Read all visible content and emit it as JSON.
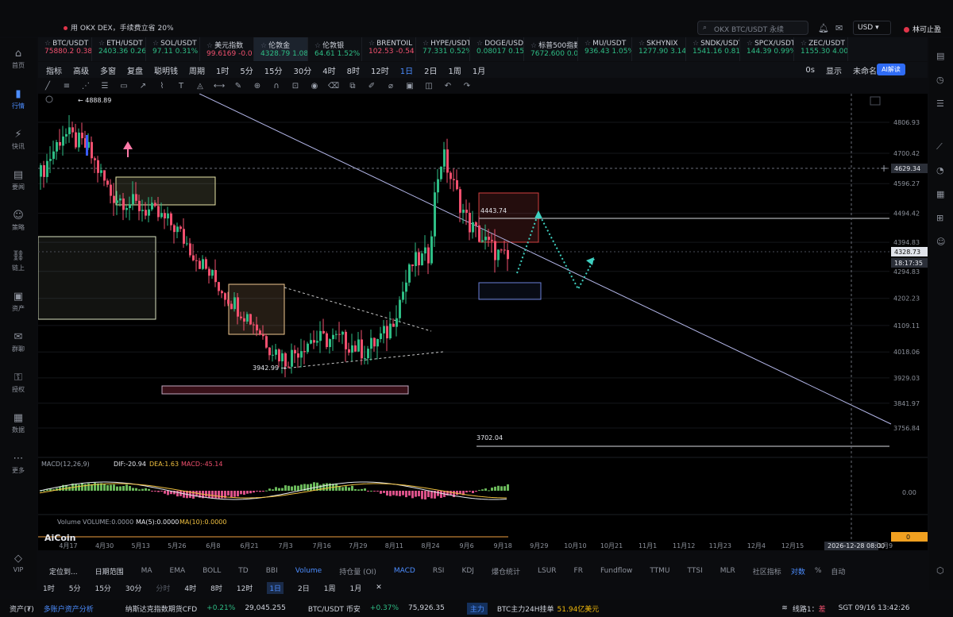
{
  "topbar": {
    "promo": "用 OKX DEX，手续费立省 20%",
    "search_placeholder": "OKX BTC/USDT 永续",
    "currency": "USD",
    "user": "林可止盈"
  },
  "tickers": [
    {
      "name": "BTC/USDT",
      "price": "75880.2",
      "chg": "0.38",
      "dir": "dn"
    },
    {
      "name": "ETH/USDT",
      "price": "2403.36",
      "chg": "0.26",
      "dir": "up"
    },
    {
      "name": "SOL/USDT",
      "price": "97.11",
      "chg": "0.31%",
      "dir": "up"
    },
    {
      "name": "美元指数",
      "price": "99.6169",
      "chg": "-0.0",
      "dir": "dn"
    },
    {
      "name": "伦敦金",
      "price": "4328.79",
      "chg": "1.08%",
      "dir": "up",
      "active": true
    },
    {
      "name": "伦敦银",
      "price": "64.61",
      "chg": "1.52%",
      "dir": "up"
    },
    {
      "name": "BRENTOIL",
      "price": "102.53",
      "chg": "-0.54",
      "dir": "dn"
    },
    {
      "name": "HYPE/USDT",
      "price": "77.331",
      "chg": "0.52%",
      "dir": "up"
    },
    {
      "name": "DOGE/USDT",
      "price": "0.08017",
      "chg": "0.15",
      "dir": "up"
    },
    {
      "name": "标普500指数",
      "price": "7672.600",
      "chg": "0.0",
      "dir": "up"
    },
    {
      "name": "MU/USDT",
      "price": "936.43",
      "chg": "1.05%",
      "dir": "up"
    },
    {
      "name": "SKHYNIX",
      "price": "1277.90",
      "chg": "3.14",
      "dir": "up"
    },
    {
      "name": "SNDK/USDT",
      "price": "1541.16",
      "chg": "0.81",
      "dir": "up"
    },
    {
      "name": "SPCX/USDT",
      "price": "144.39",
      "chg": "0.99%",
      "dir": "up"
    },
    {
      "name": "ZEC/USDT",
      "price": "1155.30",
      "chg": "4.00",
      "dir": "up"
    }
  ],
  "toolbar": {
    "items": [
      "指标",
      "高级",
      "多窗",
      "复盘",
      "聪明钱",
      "周期",
      "1时",
      "5分",
      "15分",
      "30分",
      "4时",
      "8时",
      "12时",
      "1日",
      "2日",
      "1周",
      "1月"
    ],
    "active": "1日",
    "right": [
      "0s",
      "显示",
      "未命名"
    ],
    "ai": "AI解读"
  },
  "sidebar": [
    {
      "label": "首页",
      "icon": "home-icon"
    },
    {
      "label": "行情",
      "icon": "chart-icon",
      "active": true
    },
    {
      "label": "快讯",
      "icon": "news-icon"
    },
    {
      "label": "要闻",
      "icon": "article-icon"
    },
    {
      "label": "策略",
      "icon": "robot-icon"
    },
    {
      "label": "链上",
      "icon": "chain-icon"
    },
    {
      "label": "资产",
      "icon": "wallet-icon"
    },
    {
      "label": "群聊",
      "icon": "chat-icon"
    },
    {
      "label": "授权",
      "icon": "key-icon"
    },
    {
      "label": "数据",
      "icon": "data-icon"
    },
    {
      "label": "更多",
      "icon": "more-icon"
    },
    {
      "label": "VIP",
      "icon": "vip-icon"
    }
  ],
  "chart": {
    "high_label": "← 4888.89",
    "low_label": "3942.99 →",
    "level_4443": "4443.74",
    "level_3702": "3702.04",
    "price_axis": [
      "4806.93",
      "4700.42",
      "4596.27",
      "4494.42",
      "4394.83",
      "4294.83",
      "4202.23",
      "4109.11",
      "4018.06",
      "3929.03",
      "3841.97",
      "3756.84"
    ],
    "crosshair_price": "4629.34",
    "current_price": "4328.73",
    "countdown": "18:17:35",
    "crosshair_date": "2026-12-28 08:00",
    "dates": [
      "4月17",
      "4月30",
      "5月13",
      "5月26",
      "6月8",
      "6月21",
      "7月3",
      "7月16",
      "7月29",
      "8月11",
      "8月24",
      "9月6",
      "9月18",
      "9月29",
      "10月10",
      "10月21",
      "11月1",
      "11月12",
      "11月23",
      "12月4",
      "12月15",
      "1月9"
    ],
    "macd_label": "MACD(12,26,9)",
    "dif": "DIF:-20.94",
    "dea": "DEA:1.63",
    "macd": "MACD:-45.14",
    "macd_axis": "0.00",
    "vol_label": "Volume",
    "vol": "VOLUME:0.0000",
    "ma5": "MA(5):0.0000",
    "ma10": "MA(10):0.0000",
    "vol_axis": "0",
    "brand": "AiCoin"
  },
  "bottom_tabs": {
    "left": [
      "定位到...",
      "日期范围"
    ],
    "items": [
      "MA",
      "EMA",
      "BOLL",
      "TD",
      "BBI",
      "Volume",
      "持仓量 (OI)",
      "MACD",
      "RSI",
      "KDJ",
      "爆仓统计",
      "LSUR",
      "FR",
      "Fundflow",
      "TTMU",
      "TTSI",
      "MLR"
    ],
    "active": [
      "Volume",
      "MACD"
    ],
    "right": [
      "社区指标",
      "对数",
      "%",
      "自动"
    ]
  },
  "timebar": [
    "1时",
    "5分",
    "15分",
    "30分",
    "分时",
    "4时",
    "8时",
    "12时",
    "1日",
    "2日",
    "1周",
    "1月"
  ],
  "statusbar": {
    "asset": "资产(₮)",
    "multi": "多账户资产分析",
    "nasdaq": "纳斯达克指数期货CFD",
    "nasdaq_chg": "+0.21%",
    "nasdaq_val": "29,045.255",
    "btc": "BTC/USDT 币安",
    "btc_chg": "+0.37%",
    "btc_val": "75,926.35",
    "tag": "主力",
    "main": "BTC主力24H挂单",
    "main_val": "51.94亿美元",
    "line": "线路1：",
    "line_state": "差",
    "time": "SGT 09/16 13:42:26"
  },
  "colors": {
    "up": "#2ebd85",
    "down": "#f0506e",
    "accent": "#4c8dff"
  }
}
